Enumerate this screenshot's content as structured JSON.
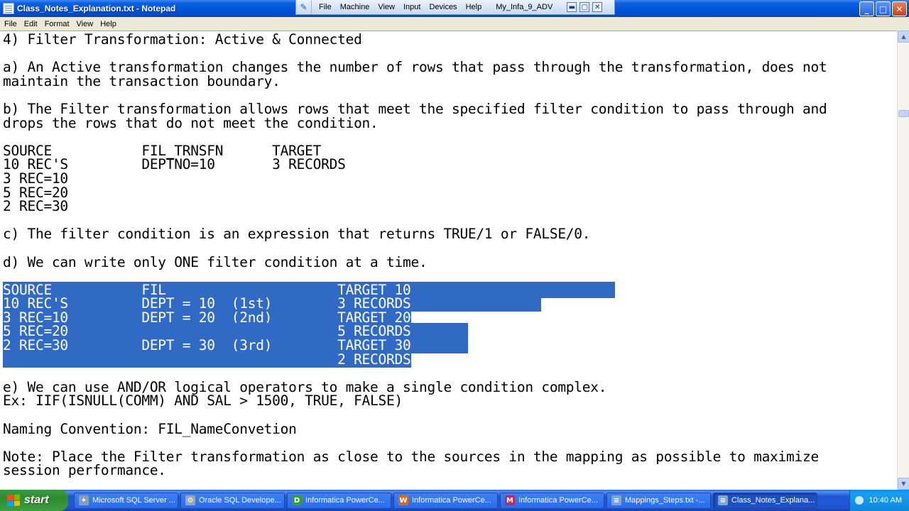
{
  "window": {
    "title": "Class_Notes_Explanation.txt - Notepad",
    "controls": {
      "minimize": "_",
      "maximize": "□",
      "close": "✕"
    }
  },
  "vm_toolbar": {
    "pin_icon": "pin-icon",
    "menus": [
      "File",
      "Machine",
      "View",
      "Input",
      "Devices",
      "Help"
    ],
    "vm_name": "My_Infa_9_ADV"
  },
  "menubar": [
    "File",
    "Edit",
    "Format",
    "View",
    "Help"
  ],
  "editor": {
    "lines_before_selection": [
      "4) Filter Transformation: Active & Connected",
      "",
      "a) An Active transformation changes the number of rows that pass through the transformation, does not",
      "maintain the transaction boundary.",
      "",
      "b) The Filter transformation allows rows that meet the specified filter condition to pass through and",
      "drops the rows that do not meet the condition.",
      "",
      "SOURCE           FIL_TRNSFN      TARGET",
      "10 REC'S         DEPTNO=10       3 RECORDS",
      "3 REC=10",
      "5 REC=20",
      "2 REC=30",
      "",
      "c) The filter condition is an expression that returns TRUE/1 or FALSE/0.",
      "",
      "d) We can write only ONE filter condition at a time.",
      ""
    ],
    "selected_lines": [
      "SOURCE           FIL                     TARGET_10                         ",
      "10 REC'S         DEPT = 10  (1st)        3 RECORDS                ",
      "3 REC=10         DEPT = 20  (2nd)        TARGET_20",
      "5 REC=20                                 5 RECORDS       ",
      "2 REC=30         DEPT = 30  (3rd)        TARGET_30       ",
      "                                         2 RECORDS"
    ],
    "lines_after_selection": [
      "",
      "e) We can use AND/OR logical operators to make a single condition complex.",
      "Ex: IIF(ISNULL(COMM) AND SAL > 1500, TRUE, FALSE)",
      "",
      "Naming Convention: FIL_NameConvetion",
      "",
      "Note: Place the Filter transformation as close to the sources in the mapping as possible to maximize",
      "session performance."
    ]
  },
  "taskbar": {
    "start_label": "start",
    "tasks": [
      {
        "label": "Microsoft SQL Server ...",
        "icon": "sql-server-icon",
        "icon_color": "#8a9bb8",
        "glyph": "✦"
      },
      {
        "label": "Oracle SQL Develope...",
        "icon": "oracle-sql-developer-icon",
        "icon_color": "#9aa7b0",
        "glyph": "⚙"
      },
      {
        "label": "Informatica PowerCe...",
        "icon": "informatica-designer-icon",
        "icon_color": "#3a9a3a",
        "glyph": "D"
      },
      {
        "label": "Informatica PowerCe...",
        "icon": "informatica-workflow-icon",
        "icon_color": "#d2691e",
        "glyph": "W"
      },
      {
        "label": "Informatica PowerCe...",
        "icon": "informatica-monitor-icon",
        "icon_color": "#b03060",
        "glyph": "M"
      },
      {
        "label": "Mappings_Steps.txt -...",
        "icon": "notepad-icon",
        "icon_color": "#7fa3d3",
        "glyph": "≡"
      },
      {
        "label": "Class_Notes_Explana...",
        "icon": "notepad-icon",
        "icon_color": "#7fa3d3",
        "glyph": "≡",
        "active": true
      }
    ],
    "clock": "10:40 AM"
  }
}
